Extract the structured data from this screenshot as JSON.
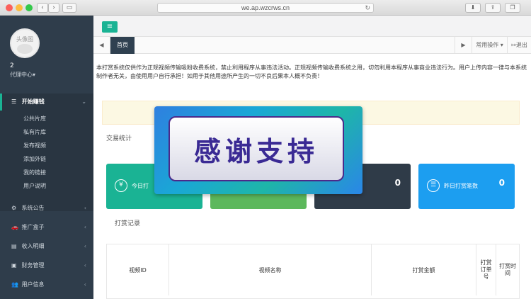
{
  "browser": {
    "url": "we.ap.wzcrws.cn",
    "back": "‹",
    "forward": "›"
  },
  "sidebar": {
    "avatar_label": "头像图",
    "user_name": "2",
    "user_role": "代理中心▾",
    "groups": [
      {
        "label": "开始赚钱",
        "icon": "☰"
      },
      {
        "label": "系统公告",
        "icon": "⚙"
      },
      {
        "label": "推广盒子",
        "icon": "🚗"
      },
      {
        "label": "收入明细",
        "icon": "▤"
      },
      {
        "label": "财务管理",
        "icon": "▣"
      },
      {
        "label": "用户信息",
        "icon": "👥"
      }
    ],
    "sub_items": [
      "公共片库",
      "私有片库",
      "发布视频",
      "添加外链",
      "我的链接",
      "用户说明"
    ]
  },
  "topbar": {
    "menu_icon": "≡"
  },
  "tabs": {
    "prev": "◀",
    "home": "首页",
    "next": "▶",
    "ops": "常用操作 ▾",
    "logout": "↦退出"
  },
  "notice": {
    "line1": "本打赏系统仅供作为正规视频传输吸粉收费系统，禁止利用程序从事违法活动。正规视频传输收费系统之用，切勿利用本程序从事商业违法行为。用户上传内容一律与本系统制作者无关，由使用用户自行承担！如用于其他用途所产生的一切不良后果本人概不负责！"
  },
  "stats": {
    "title": "交易统计",
    "cards": [
      {
        "label": "今日打",
        "value": "",
        "icon": "¥",
        "color": "#1ab394"
      },
      {
        "label": "",
        "value": "",
        "icon": "",
        "color": "#5cb85c"
      },
      {
        "label": "",
        "value": "0",
        "icon": "",
        "color": "#2f3b48"
      },
      {
        "label": "昨日打赏笔数",
        "value": "0",
        "icon": "☰",
        "color": "#1c9ef0"
      }
    ]
  },
  "records": {
    "title": "打赏记录",
    "columns": [
      "视频ID",
      "视频名称",
      "打赏金额",
      "打赏订单号",
      "打赏时间"
    ]
  },
  "overlay": {
    "text": "感谢支持"
  }
}
